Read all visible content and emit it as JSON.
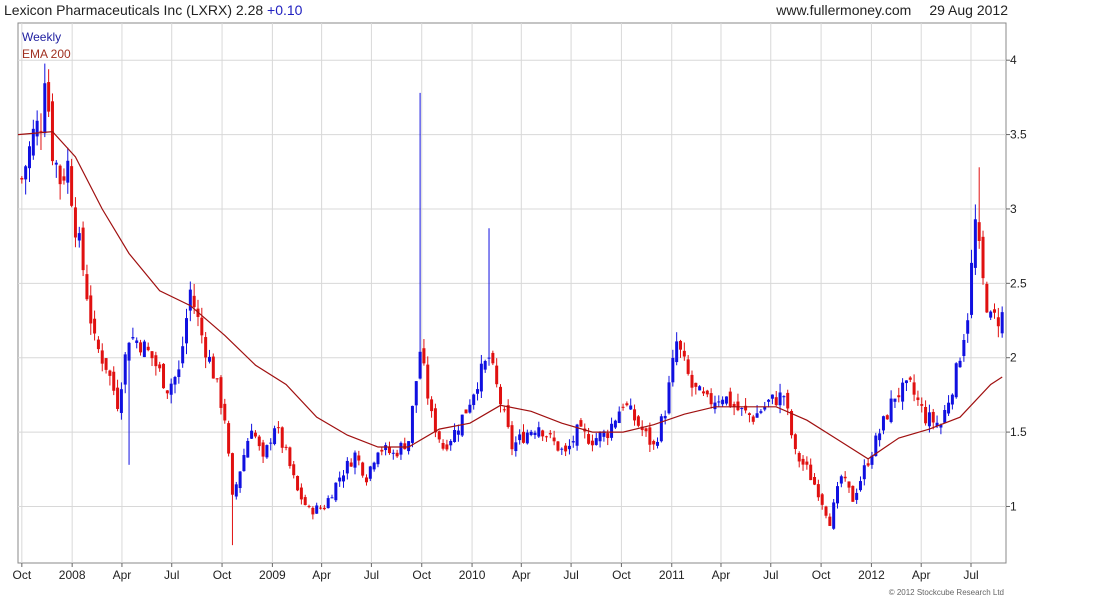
{
  "header": {
    "security": "Lexicon Pharmaceuticals Inc (LXRX)",
    "last": "2.28",
    "change": "+0.10",
    "site": "www.fullermoney.com",
    "date": "29 Aug 2012"
  },
  "copyright": "© 2012 Stockcube Research Ltd",
  "colors": {
    "up": "#1010e0",
    "down": "#e01010",
    "ema": "#a01010",
    "grid": "#d8d8d8",
    "legend_weekly": "#2020a0",
    "legend_ema": "#a03020"
  },
  "chart_data": {
    "type": "candlestick",
    "title": "Lexicon Pharmaceuticals Inc (LXRX)",
    "period": "Weekly",
    "ylim": [
      0.62,
      4.25
    ],
    "yticks": [
      1,
      1.5,
      2,
      2.5,
      3,
      3.5,
      4
    ],
    "ytick_labels": [
      "1",
      "1.5",
      "2",
      "2.5",
      "3",
      "3.5",
      "4"
    ],
    "xlim": [
      "2007-09-24",
      "2012-09-03"
    ],
    "xticks": [
      {
        "date": "2007-10-01",
        "label": "Oct"
      },
      {
        "date": "2008-01-01",
        "label": "2008"
      },
      {
        "date": "2008-04-01",
        "label": "Apr"
      },
      {
        "date": "2008-07-01",
        "label": "Jul"
      },
      {
        "date": "2008-10-01",
        "label": "Oct"
      },
      {
        "date": "2009-01-01",
        "label": "2009"
      },
      {
        "date": "2009-04-01",
        "label": "Apr"
      },
      {
        "date": "2009-07-01",
        "label": "Jul"
      },
      {
        "date": "2009-10-01",
        "label": "Oct"
      },
      {
        "date": "2010-01-01",
        "label": "2010"
      },
      {
        "date": "2010-04-01",
        "label": "Apr"
      },
      {
        "date": "2010-07-01",
        "label": "Jul"
      },
      {
        "date": "2010-10-01",
        "label": "Oct"
      },
      {
        "date": "2011-01-01",
        "label": "2011"
      },
      {
        "date": "2011-04-01",
        "label": "Apr"
      },
      {
        "date": "2011-07-01",
        "label": "Jul"
      },
      {
        "date": "2011-10-01",
        "label": "Oct"
      },
      {
        "date": "2012-01-01",
        "label": "2012"
      },
      {
        "date": "2012-04-01",
        "label": "Apr"
      },
      {
        "date": "2012-07-01",
        "label": "Jul"
      }
    ],
    "legend": [
      {
        "label": "Weekly"
      },
      {
        "label": "EMA 200"
      }
    ],
    "series": [
      {
        "name": "Weekly",
        "price_path": [
          [
            "2007-10-01",
            3.2
          ],
          [
            "2007-10-22",
            3.5
          ],
          [
            "2007-11-05",
            3.6
          ],
          [
            "2007-11-12",
            3.95
          ],
          [
            "2007-11-26",
            3.4
          ],
          [
            "2007-12-10",
            3.2
          ],
          [
            "2007-12-24",
            3.3
          ],
          [
            "2008-01-07",
            2.9
          ],
          [
            "2008-01-21",
            2.6
          ],
          [
            "2008-02-11",
            2.1
          ],
          [
            "2008-03-03",
            1.95
          ],
          [
            "2008-03-24",
            1.7
          ],
          [
            "2008-04-14",
            2.15
          ],
          [
            "2008-05-05",
            2.1
          ],
          [
            "2008-05-26",
            2.0
          ],
          [
            "2008-06-23",
            1.8
          ],
          [
            "2008-07-14",
            1.9
          ],
          [
            "2008-08-04",
            2.45
          ],
          [
            "2008-08-25",
            2.15
          ],
          [
            "2008-09-15",
            1.9
          ],
          [
            "2008-10-06",
            1.6
          ],
          [
            "2008-10-20",
            1.05
          ],
          [
            "2008-11-03",
            1.25
          ],
          [
            "2008-11-24",
            1.55
          ],
          [
            "2008-12-15",
            1.3
          ],
          [
            "2009-01-05",
            1.55
          ],
          [
            "2009-01-26",
            1.35
          ],
          [
            "2009-02-16",
            1.1
          ],
          [
            "2009-03-09",
            0.97
          ],
          [
            "2009-04-06",
            1.0
          ],
          [
            "2009-05-04",
            1.2
          ],
          [
            "2009-06-01",
            1.35
          ],
          [
            "2009-06-22",
            1.2
          ],
          [
            "2009-07-13",
            1.4
          ],
          [
            "2009-08-10",
            1.35
          ],
          [
            "2009-09-07",
            1.45
          ],
          [
            "2009-09-28",
            2.05
          ],
          [
            "2009-10-19",
            1.6
          ],
          [
            "2009-11-09",
            1.4
          ],
          [
            "2009-11-30",
            1.5
          ],
          [
            "2009-12-21",
            1.65
          ],
          [
            "2010-01-11",
            1.85
          ],
          [
            "2010-02-01",
            2.0
          ],
          [
            "2010-02-22",
            1.7
          ],
          [
            "2010-03-15",
            1.4
          ],
          [
            "2010-04-12",
            1.5
          ],
          [
            "2010-05-03",
            1.55
          ],
          [
            "2010-05-24",
            1.45
          ],
          [
            "2010-06-21",
            1.35
          ],
          [
            "2010-07-12",
            1.5
          ],
          [
            "2010-08-09",
            1.45
          ],
          [
            "2010-09-06",
            1.5
          ],
          [
            "2010-10-04",
            1.7
          ],
          [
            "2010-11-01",
            1.55
          ],
          [
            "2010-11-29",
            1.4
          ],
          [
            "2010-12-20",
            1.65
          ],
          [
            "2011-01-10",
            2.1
          ],
          [
            "2011-02-07",
            1.8
          ],
          [
            "2011-03-07",
            1.7
          ],
          [
            "2011-04-04",
            1.75
          ],
          [
            "2011-05-02",
            1.65
          ],
          [
            "2011-05-30",
            1.6
          ],
          [
            "2011-06-27",
            1.7
          ],
          [
            "2011-07-25",
            1.75
          ],
          [
            "2011-08-15",
            1.35
          ],
          [
            "2011-09-05",
            1.25
          ],
          [
            "2011-09-26",
            1.1
          ],
          [
            "2011-10-17",
            0.9
          ],
          [
            "2011-11-07",
            1.2
          ],
          [
            "2011-11-28",
            1.05
          ],
          [
            "2011-12-19",
            1.25
          ],
          [
            "2012-01-16",
            1.5
          ],
          [
            "2012-02-13",
            1.75
          ],
          [
            "2012-03-12",
            1.8
          ],
          [
            "2012-04-09",
            1.6
          ],
          [
            "2012-05-07",
            1.55
          ],
          [
            "2012-06-04",
            1.9
          ],
          [
            "2012-06-25",
            2.3
          ],
          [
            "2012-07-09",
            2.9
          ],
          [
            "2012-07-23",
            2.5
          ],
          [
            "2012-08-06",
            2.25
          ],
          [
            "2012-08-27",
            2.28
          ]
        ],
        "spikes": [
          {
            "date": "2009-09-28",
            "high": 3.78
          },
          {
            "date": "2010-02-01",
            "high": 2.87
          },
          {
            "date": "2012-07-16",
            "high": 3.28
          },
          {
            "date": "2008-04-14",
            "low": 1.28
          },
          {
            "date": "2008-10-20",
            "low": 0.74
          }
        ]
      },
      {
        "name": "EMA 200",
        "values": [
          [
            "2007-09-24",
            3.5
          ],
          [
            "2007-11-26",
            3.52
          ],
          [
            "2008-01-07",
            3.35
          ],
          [
            "2008-02-25",
            3.0
          ],
          [
            "2008-04-14",
            2.7
          ],
          [
            "2008-06-09",
            2.45
          ],
          [
            "2008-08-04",
            2.35
          ],
          [
            "2008-10-06",
            2.15
          ],
          [
            "2008-12-01",
            1.95
          ],
          [
            "2009-01-26",
            1.82
          ],
          [
            "2009-03-23",
            1.6
          ],
          [
            "2009-05-18",
            1.48
          ],
          [
            "2009-07-13",
            1.4
          ],
          [
            "2009-09-07",
            1.4
          ],
          [
            "2009-11-02",
            1.52
          ],
          [
            "2009-12-28",
            1.56
          ],
          [
            "2010-02-22",
            1.68
          ],
          [
            "2010-04-19",
            1.64
          ],
          [
            "2010-06-14",
            1.56
          ],
          [
            "2010-08-09",
            1.5
          ],
          [
            "2010-10-04",
            1.5
          ],
          [
            "2010-11-29",
            1.55
          ],
          [
            "2011-01-24",
            1.62
          ],
          [
            "2011-03-21",
            1.67
          ],
          [
            "2011-05-16",
            1.67
          ],
          [
            "2011-07-11",
            1.67
          ],
          [
            "2011-09-05",
            1.58
          ],
          [
            "2011-10-31",
            1.45
          ],
          [
            "2011-12-26",
            1.32
          ],
          [
            "2012-02-20",
            1.46
          ],
          [
            "2012-04-16",
            1.52
          ],
          [
            "2012-06-11",
            1.6
          ],
          [
            "2012-08-06",
            1.82
          ],
          [
            "2012-08-27",
            1.87
          ]
        ]
      }
    ]
  }
}
